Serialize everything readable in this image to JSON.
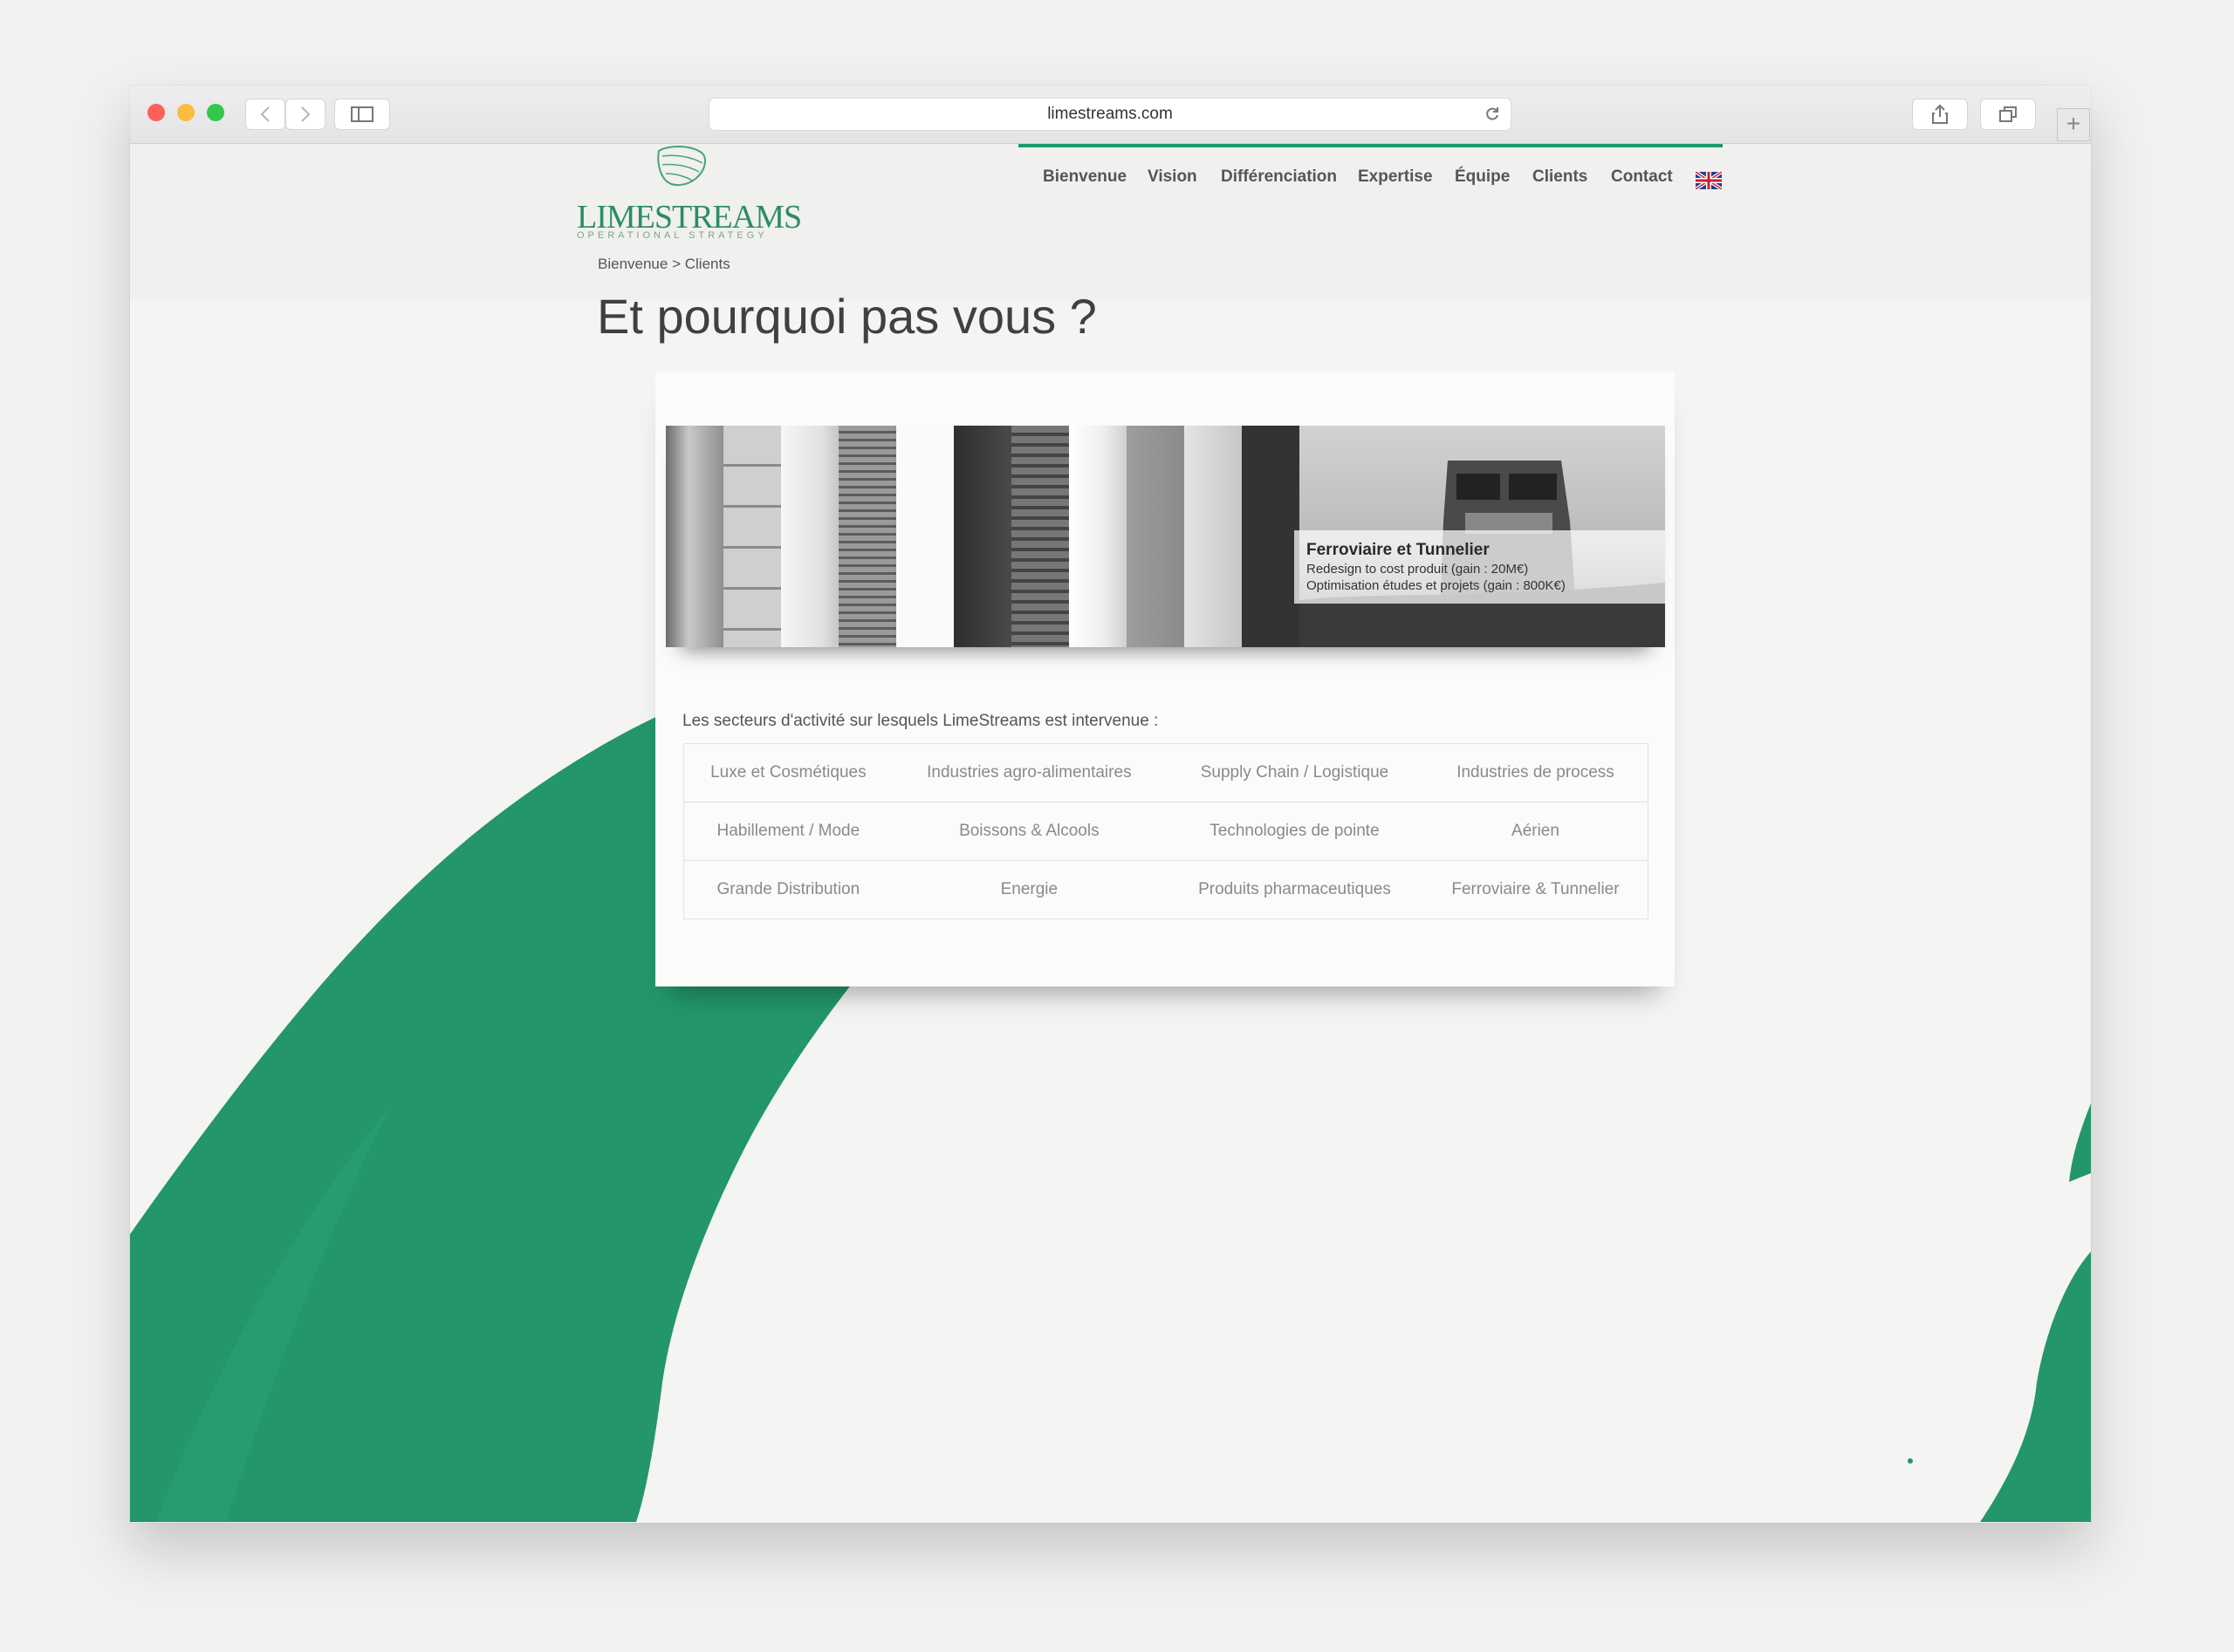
{
  "browser": {
    "url": "limestreams.com"
  },
  "site": {
    "logo": "LIMESTREAMS",
    "tagline": "OPERATIONAL STRATEGY",
    "nav": [
      "Bienvenue",
      "Vision",
      "Différenciation",
      "Expertise",
      "Équipe",
      "Clients",
      "Contact"
    ],
    "language_flag": "uk-flag-icon"
  },
  "breadcrumb": {
    "home": "Bienvenue",
    "separator": ">",
    "current": "Clients"
  },
  "page": {
    "title": "Et pourquoi pas vous ?"
  },
  "banner": {
    "caption_title": "Ferroviaire et Tunnelier",
    "caption_line1": "Redesign to cost produit (gain : 20M€)",
    "caption_line2": "Optimisation études et projets (gain : 800K€)"
  },
  "sectors": {
    "intro": "Les secteurs d'activité sur lesquels LimeStreams est intervenue :",
    "rows": [
      [
        "Luxe et Cosmétiques",
        "Industries agro-alimentaires",
        "Supply Chain / Logistique",
        "Industries de process"
      ],
      [
        "Habillement / Mode",
        "Boissons & Alcools",
        "Technologies de pointe",
        "Aérien"
      ],
      [
        "Grande Distribution",
        "Energie",
        "Produits pharmaceutiques",
        "Ferroviaire & Tunnelier"
      ]
    ]
  },
  "colors": {
    "accent": "#1d9a6c",
    "logo": "#2c8d61"
  }
}
